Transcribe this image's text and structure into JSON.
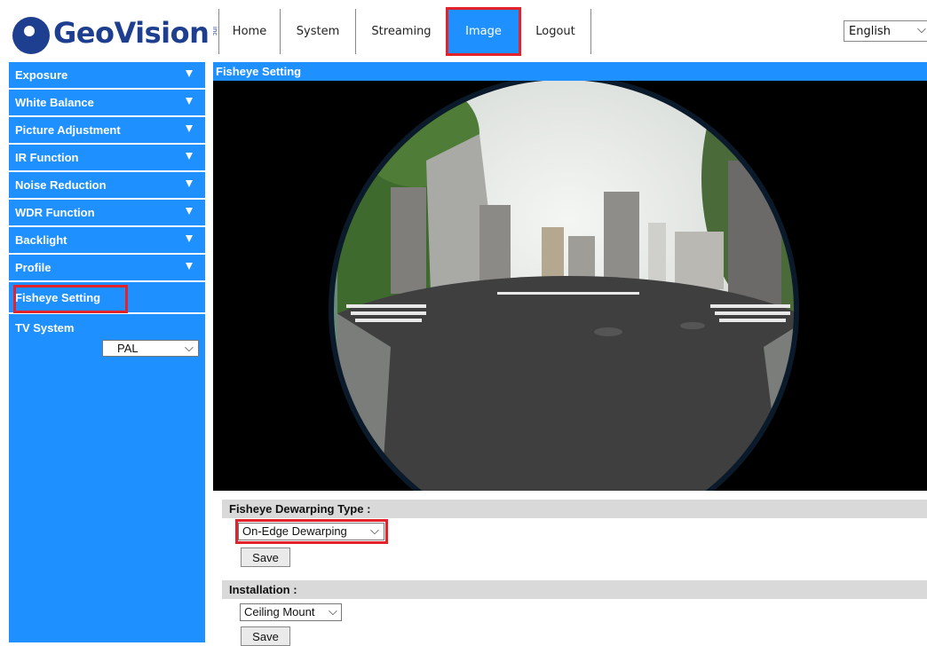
{
  "header": {
    "logo_text": "GeoVision",
    "logo_suffix": "inc",
    "nav": [
      {
        "label": "Home"
      },
      {
        "label": "System"
      },
      {
        "label": "Streaming"
      },
      {
        "label": "Image",
        "active": true
      },
      {
        "label": "Logout"
      }
    ],
    "language": "English"
  },
  "sidebar": {
    "items": [
      {
        "label": "Exposure"
      },
      {
        "label": "White Balance"
      },
      {
        "label": "Picture Adjustment"
      },
      {
        "label": "IR Function"
      },
      {
        "label": "Noise Reduction"
      },
      {
        "label": "WDR Function"
      },
      {
        "label": "Backlight"
      },
      {
        "label": "Profile"
      },
      {
        "label": "Fisheye Setting"
      }
    ],
    "tv_system_label": "TV System",
    "tv_system_value": "PAL"
  },
  "main": {
    "title": "Fisheye Setting",
    "dewarping_label": "Fisheye Dewarping Type :",
    "dewarping_value": "On-Edge Dewarping",
    "save_label": "Save",
    "installation_label": "Installation :",
    "installation_value": "Ceiling Mount"
  },
  "colors": {
    "accent_blue": "#1e90ff",
    "logo_blue": "#1e3f8f",
    "highlight_red": "#e3222b",
    "section_gray": "#d9d9d9"
  }
}
